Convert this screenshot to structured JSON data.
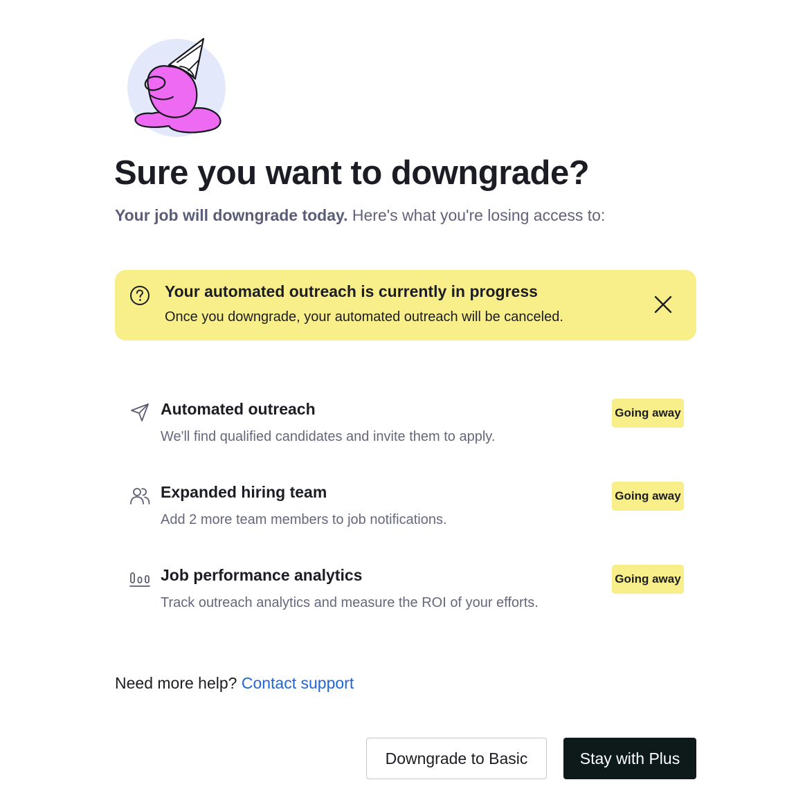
{
  "modal": {
    "title": "Sure you want to downgrade?",
    "subtitle_strong": "Your job will downgrade today.",
    "subtitle_rest": " Here's what you're losing access to:"
  },
  "alert": {
    "icon": "question-circle-icon",
    "title": "Your automated outreach is currently in progress",
    "body": "Once you downgrade, your automated outreach will be canceled.",
    "close_icon": "close-icon",
    "background": "#f8ee8a"
  },
  "features": [
    {
      "icon": "paper-plane-icon",
      "title": "Automated outreach",
      "description": "We'll find qualified candidates and invite them to apply.",
      "badge": "Going away"
    },
    {
      "icon": "users-icon",
      "title": "Expanded hiring team",
      "description": "Add 2 more team members to job notifications.",
      "badge": "Going away"
    },
    {
      "icon": "bar-chart-icon",
      "title": "Job performance analytics",
      "description": "Track outreach analytics and measure the ROI of your efforts.",
      "badge": "Going away"
    }
  ],
  "help": {
    "text": "Need more help?",
    "link": "Contact support"
  },
  "actions": {
    "secondary": "Downgrade to Basic",
    "primary": "Stay with Plus"
  },
  "colors": {
    "accent_yellow": "#f8ee8a",
    "illustration_pink": "#ee6af2",
    "illustration_circle": "#e3e9fb",
    "link_blue": "#1f66d6",
    "primary_button": "#0d1a19"
  }
}
